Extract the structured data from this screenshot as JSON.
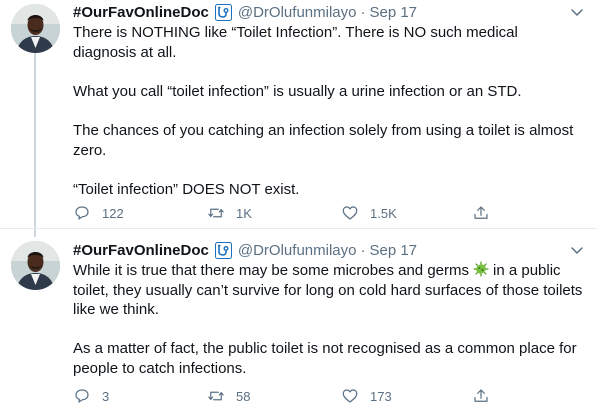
{
  "tweets": [
    {
      "display_name": "#OurFavOnlineDoc",
      "handle": "@DrOlufunmilayo",
      "separator": "·",
      "date": "Sep 17",
      "paragraphs": [
        "There is NOTHING like “Toilet Infection”. There is NO such medical diagnosis at all.",
        "What you call “toilet infection” is usually a urine infection or an STD.",
        "The chances of you catching an infection solely from using a toilet is almost zero.",
        "“Toilet infection” DOES NOT exist."
      ],
      "reply_count": "122",
      "retweet_count": "1K",
      "like_count": "1.5K"
    },
    {
      "display_name": "#OurFavOnlineDoc",
      "handle": "@DrOlufunmilayo",
      "separator": "·",
      "date": "Sep 17",
      "para1_before_emoji": "While it is true that there may be some microbes and germs",
      "para1_after_emoji": "in a public toilet, they usually can’t survive for long on cold hard surfaces of those toilets like we think.",
      "paragraphs": [
        "As a matter of fact, the public toilet is not recognised as a common place for people to catch infections."
      ],
      "reply_count": "3",
      "retweet_count": "58",
      "like_count": "173"
    }
  ],
  "icons": {
    "badge": "medical-badge-icon",
    "caret": "chevron-down-icon",
    "emoji": "microbe-emoji",
    "reply": "reply-icon",
    "retweet": "retweet-icon",
    "like": "like-icon",
    "share": "share-icon"
  },
  "colors": {
    "name": "#0f1419",
    "secondary": "#5b7083",
    "thread_line": "#ccd6dd",
    "divider": "#e6ecf0",
    "badge": "#1d6fbf"
  }
}
